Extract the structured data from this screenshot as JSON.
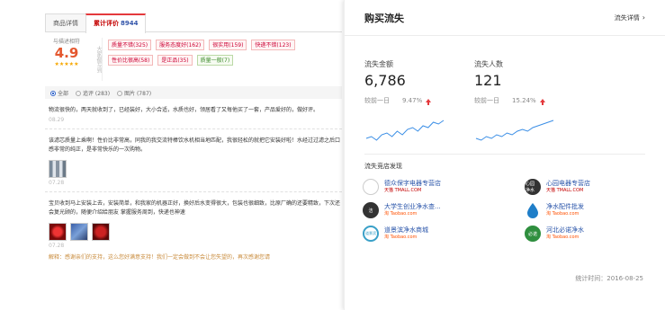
{
  "left": {
    "tabs": [
      {
        "label": "商品详情"
      },
      {
        "label": "累计评价",
        "count": "8944"
      }
    ],
    "rating": {
      "label": "与描述相符",
      "score": "4.9",
      "stars": "★★★★★",
      "stars_value": 5,
      "vertical_label": "大家都写到"
    },
    "tags": [
      {
        "text": "质量不错(325)",
        "tone": "red"
      },
      {
        "text": "服务态度好(162)",
        "tone": "red"
      },
      {
        "text": "很实用(159)",
        "tone": "red"
      },
      {
        "text": "快递不错(123)",
        "tone": "red"
      },
      {
        "text": "性价比很高(58)",
        "tone": "red"
      },
      {
        "text": "是正品(35)",
        "tone": "red"
      },
      {
        "text": "质量一般(7)",
        "tone": "green"
      }
    ],
    "filter": {
      "all": "全部",
      "append": "追评 (283)",
      "images": "图片 (787)"
    },
    "reviews": [
      {
        "text": "物流很快的，两天就收到了，已经装好，大小合适，水质也好，领居看了又每他买了一套，产品爱好的，做好评。",
        "date": "08.29"
      },
      {
        "text": "该滤芯质量上乘啊！性价比非常高，同我的我交流特棒饮水机相当地匹配，我很轻松的就把它安装好啦！水经过过滤之后口感非常的纯正，是非常快乐的一次购物。",
        "date": "07.28",
        "images": 1
      },
      {
        "text": "宝贝收到马上安装上去，安装简单，和我家的机器正好，换好后水变得很大，包装也很细致，比原厂确的还要精致，下次还会复光顾的，随便介绍给朋友 掌握服务周到，快递也神速",
        "date": "07.28",
        "images": 3,
        "reply": "解释：感谢亲们的支持，这么您好满意支持！我们一定会做到不会让您失望的，再次感谢您请"
      }
    ]
  },
  "right": {
    "title": "购买流失",
    "detail_link": "流失详情",
    "metrics": [
      {
        "label": "流失金额",
        "value": "6,786",
        "compare_label": "较前一日",
        "compare_value": "9.47%",
        "trend": "up"
      },
      {
        "label": "流失人数",
        "value": "121",
        "compare_label": "较前一日",
        "compare_value": "15.24%",
        "trend": "up"
      }
    ],
    "sparklines": [
      [
        3,
        4,
        2,
        5,
        6,
        4,
        7,
        5,
        8,
        9,
        7,
        10,
        9,
        12,
        11,
        13
      ],
      [
        3,
        2,
        4,
        3,
        5,
        4,
        6,
        5,
        7,
        8,
        7,
        9,
        10,
        11,
        12,
        13
      ]
    ],
    "accent_color": "#3a8ee6",
    "competitor_title": "流失竞店发现",
    "stores": [
      {
        "name": "德众保字电器专营店",
        "platform": "天猫 TMALL.COM",
        "platform_type": "tmall",
        "logo": "circle"
      },
      {
        "name": "心园电器专营店",
        "platform": "天猫 TMALL.COM",
        "platform_type": "tmall",
        "logo": "dark",
        "logo_text": "心园 净水"
      },
      {
        "name": "大学生创业净水查...",
        "platform": "淘 Taobao.com",
        "platform_type": "taobao",
        "logo": "dark",
        "logo_text": "洁"
      },
      {
        "name": "净水配件批发",
        "platform": "淘 Taobao.com",
        "platform_type": "taobao",
        "logo": "drop"
      },
      {
        "name": "道景滨净水商城",
        "platform": "淘 Taobao.com",
        "platform_type": "taobao",
        "logo": "ring",
        "logo_text": "道景滨"
      },
      {
        "name": "河北必诺净水",
        "platform": "淘 Taobao.com",
        "platform_type": "taobao",
        "logo": "green",
        "logo_text": "必诺"
      }
    ],
    "stat_time": "统计时间：2016-08-25"
  }
}
